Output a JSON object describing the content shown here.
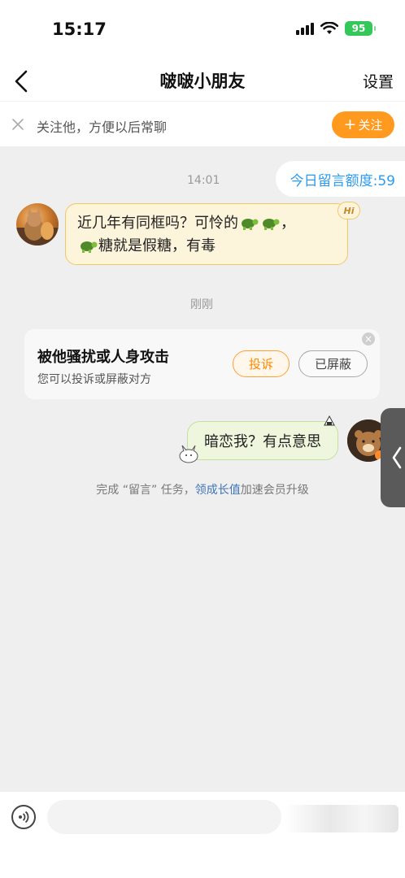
{
  "status_bar": {
    "time": "15:17",
    "battery": "95"
  },
  "header": {
    "title": "啵啵小朋友",
    "settings_label": "设置"
  },
  "follow_bar": {
    "hint": "关注他，方便以后常聊",
    "follow_label": "关注",
    "follow_plus": "+"
  },
  "chat": {
    "quota_label": "今日留言额度:59",
    "timestamp_1": "14:01",
    "message_1": {
      "line_1": "近几年有同框吗？可怜的",
      "line_1_end": "，",
      "line_2": "糖就是假糖，有毒"
    },
    "hi_badge": "Hi",
    "timestamp_2": "刚刚",
    "harass_card": {
      "title": "被他骚扰或人身攻击",
      "description": "您可以投诉或屏蔽对方",
      "report_label": "投诉",
      "blocked_label": "已屏蔽"
    },
    "message_2": "暗恋我？有点意思",
    "task_tip": {
      "prefix": "完成 “留言” 任务，",
      "link": "领成长值",
      "suffix": "加速会员升级"
    }
  },
  "input_bar": {
    "placeholder": ""
  },
  "colors": {
    "accent_orange": "#ff9a1f",
    "link_blue": "#2a9bf1",
    "bubble_yellow": "#fdf4dc",
    "bubble_green": "#eef7dd"
  }
}
